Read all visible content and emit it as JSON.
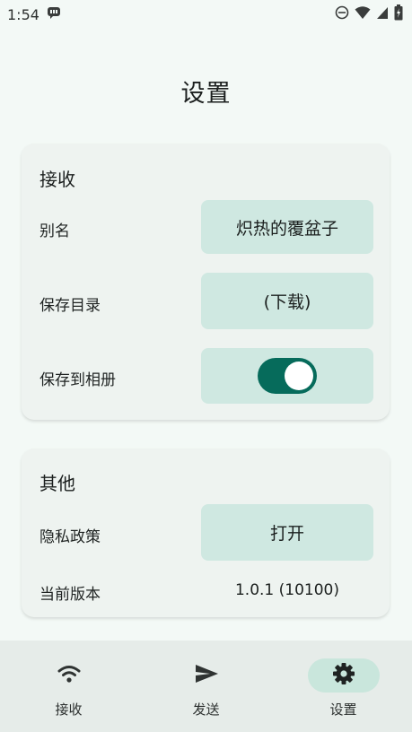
{
  "status_bar": {
    "time": "1:54"
  },
  "page_title": "设置",
  "receive_section": {
    "title": "接收",
    "alias_label": "别名",
    "alias_value": "炽热的覆盆子",
    "save_dir_label": "保存目录",
    "save_dir_value": "(下载)",
    "save_album_label": "保存到相册",
    "save_album_enabled": true
  },
  "other_section": {
    "title": "其他",
    "privacy_label": "隐私政策",
    "privacy_button": "打开",
    "version_label": "当前版本",
    "version_value": "1.0.1 (10100)"
  },
  "bottom_nav": {
    "items": [
      {
        "label": "接收",
        "icon": "wifi-icon",
        "active": false
      },
      {
        "label": "发送",
        "icon": "send-icon",
        "active": false
      },
      {
        "label": "设置",
        "icon": "gear-icon",
        "active": true
      }
    ]
  },
  "colors": {
    "accent": "#066b5b",
    "button_bg": "#cfe8e1",
    "card_bg": "#eef3f0",
    "background": "#f3f9f6"
  }
}
